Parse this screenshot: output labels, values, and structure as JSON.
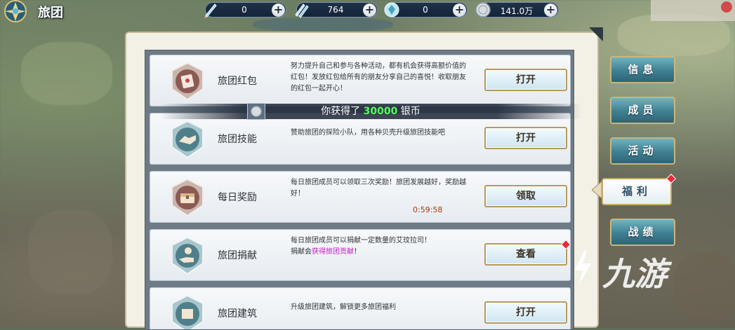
{
  "header": {
    "title": "旅团"
  },
  "resources": [
    {
      "icon": "quill-icon",
      "value": "0"
    },
    {
      "icon": "double-quill-icon",
      "value": "764"
    },
    {
      "icon": "gem-badge-icon",
      "value": "0"
    },
    {
      "icon": "silver-coin-icon",
      "value": "141.0万"
    }
  ],
  "resource_plus": "+",
  "rows": [
    {
      "name": "旅团红包",
      "desc": "努力提升自己和参与各种活动，都有机会获得高额价值的红包！发放红包给所有的朋友分享自己的喜悦！收取朋友的红包一起开心！",
      "button": "打开"
    },
    {
      "name": "旅团技能",
      "desc": "赞助旅团的探险小队，用各种贝壳升级旅团技能吧",
      "button": "打开"
    },
    {
      "name": "每日奖励",
      "desc": "每日旅团成员可以领取三次奖励！旅团发展越好，奖励越好！",
      "timer": "0:59:58",
      "button": "领取"
    },
    {
      "name": "旅团捐献",
      "desc_line1": "每日旅团成员可以捐献一定数量的艾玟拉司！",
      "desc_prefix": "捐献会",
      "desc_highlight": "获得旅团贡献",
      "desc_suffix": "！",
      "button": "查看"
    },
    {
      "name": "旅团建筑",
      "desc": "升级旅团建筑，解锁更多旅团福利",
      "button": "打开"
    }
  ],
  "toast": {
    "prefix": "你获得了 ",
    "amount": "30000",
    "suffix": " 银币"
  },
  "tabs": [
    {
      "label": "信息"
    },
    {
      "label": "成员"
    },
    {
      "label": "活动"
    },
    {
      "label": "福利"
    },
    {
      "label": "战绩"
    }
  ],
  "watermark": "九游",
  "colors": {
    "accent_green": "#54ff5c",
    "badge_red": "#e8283d",
    "highlight_purple": "#c21bc5",
    "tab_teal": "#3f7f92"
  }
}
